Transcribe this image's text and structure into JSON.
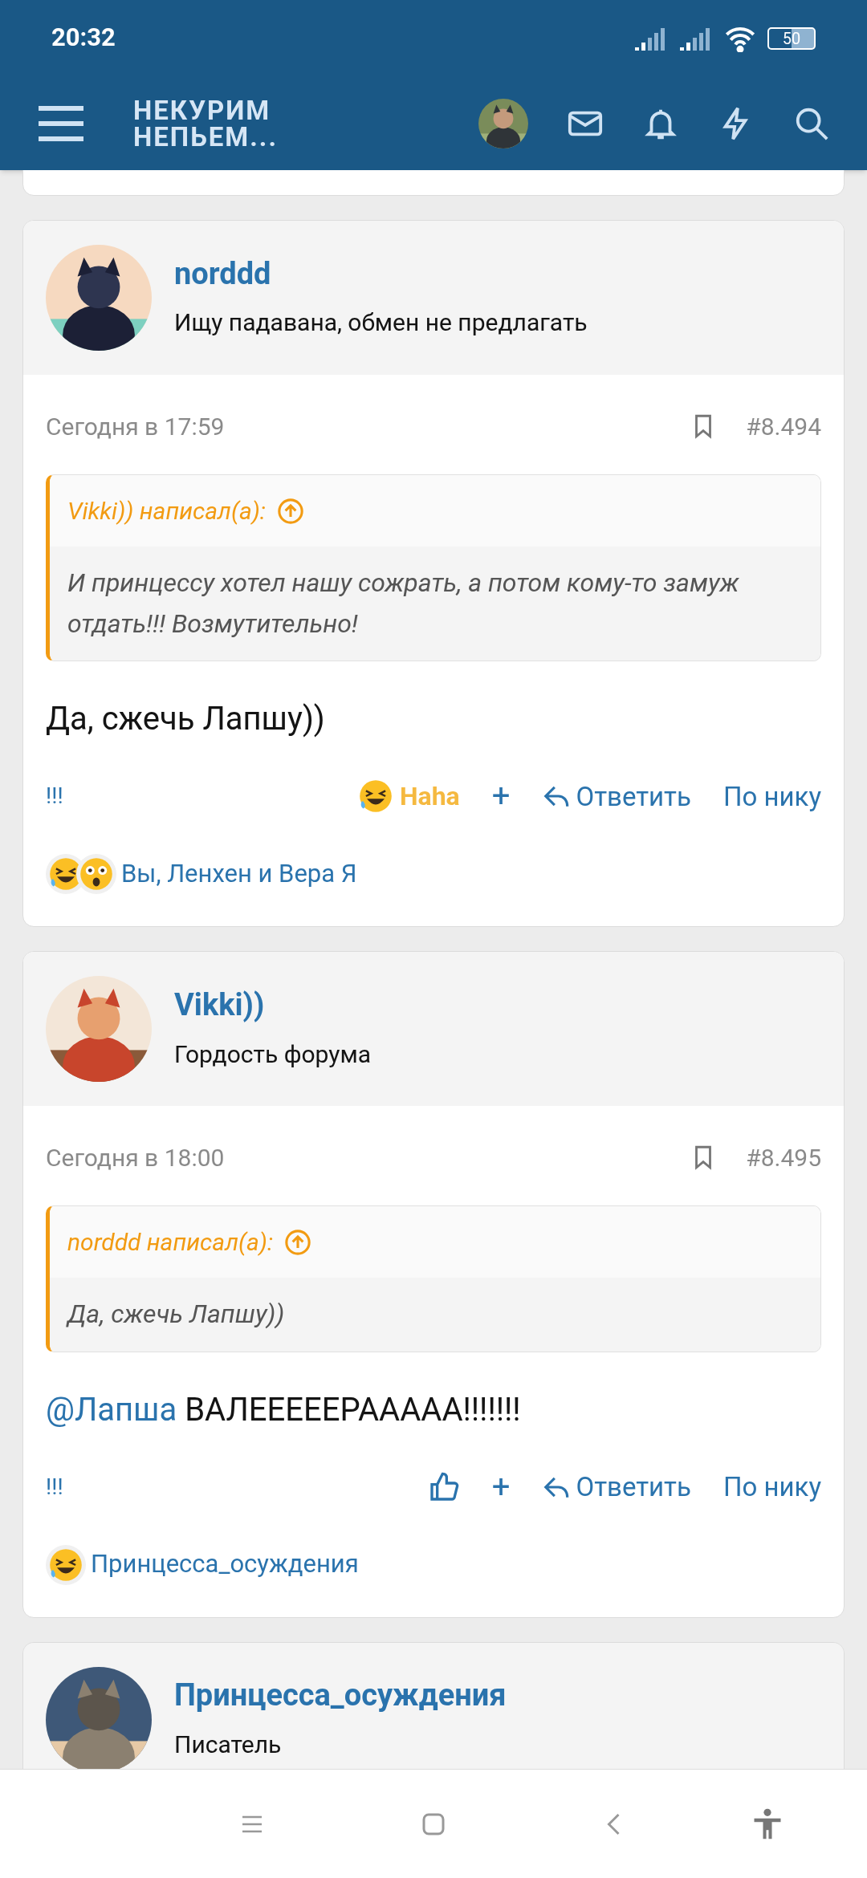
{
  "status_bar": {
    "time": "20:32",
    "battery": "50"
  },
  "header": {
    "logo_lines": [
      "НЕКУРИМ",
      "НЕПЬЕМ..."
    ]
  },
  "posts": [
    {
      "author": "norddd",
      "user_title": "Ищу падавана, обмен не предлагать",
      "date": "Сегодня в 17:59",
      "number": "#8.494",
      "quote": {
        "author_line": "Vikki)) написал(а):",
        "text": "И принцессу хотел нашу сожрать, а потом кому-то замуж отдать!!! Возмутительно!"
      },
      "message": [
        {
          "kind": "text",
          "text": "Да, сжечь Лапшу))"
        }
      ],
      "flag": "!!!",
      "reaction": {
        "kind": "haha",
        "label": "Haha",
        "selected": true
      },
      "plus": "+",
      "reply": "Ответить",
      "by_nick": "По нику",
      "reactions_summary": {
        "emojis": [
          {
            "kind": "haha"
          },
          {
            "kind": "wow"
          }
        ],
        "text": "Вы, Ленхен и Вера Я"
      }
    },
    {
      "author": "Vikki))",
      "user_title": "Гордость форума",
      "date": "Сегодня в 18:00",
      "number": "#8.495",
      "quote": {
        "author_line": "norddd написал(а):",
        "text": "Да, сжечь Лапшу))"
      },
      "message": [
        {
          "kind": "mention",
          "text": "@Лапша"
        },
        {
          "kind": "text",
          "text": " ВАЛЕЕЕЕЕРААААА!!!!!!!"
        }
      ],
      "flag": "!!!",
      "reaction": {
        "kind": "like",
        "selected": false
      },
      "plus": "+",
      "reply": "Ответить",
      "by_nick": "По нику",
      "reactions_summary": {
        "emojis": [
          {
            "kind": "haha"
          }
        ],
        "text": "Принцесса_осуждения"
      }
    },
    {
      "author": "Принцесса_осуждения",
      "user_title": "Писатель"
    }
  ]
}
